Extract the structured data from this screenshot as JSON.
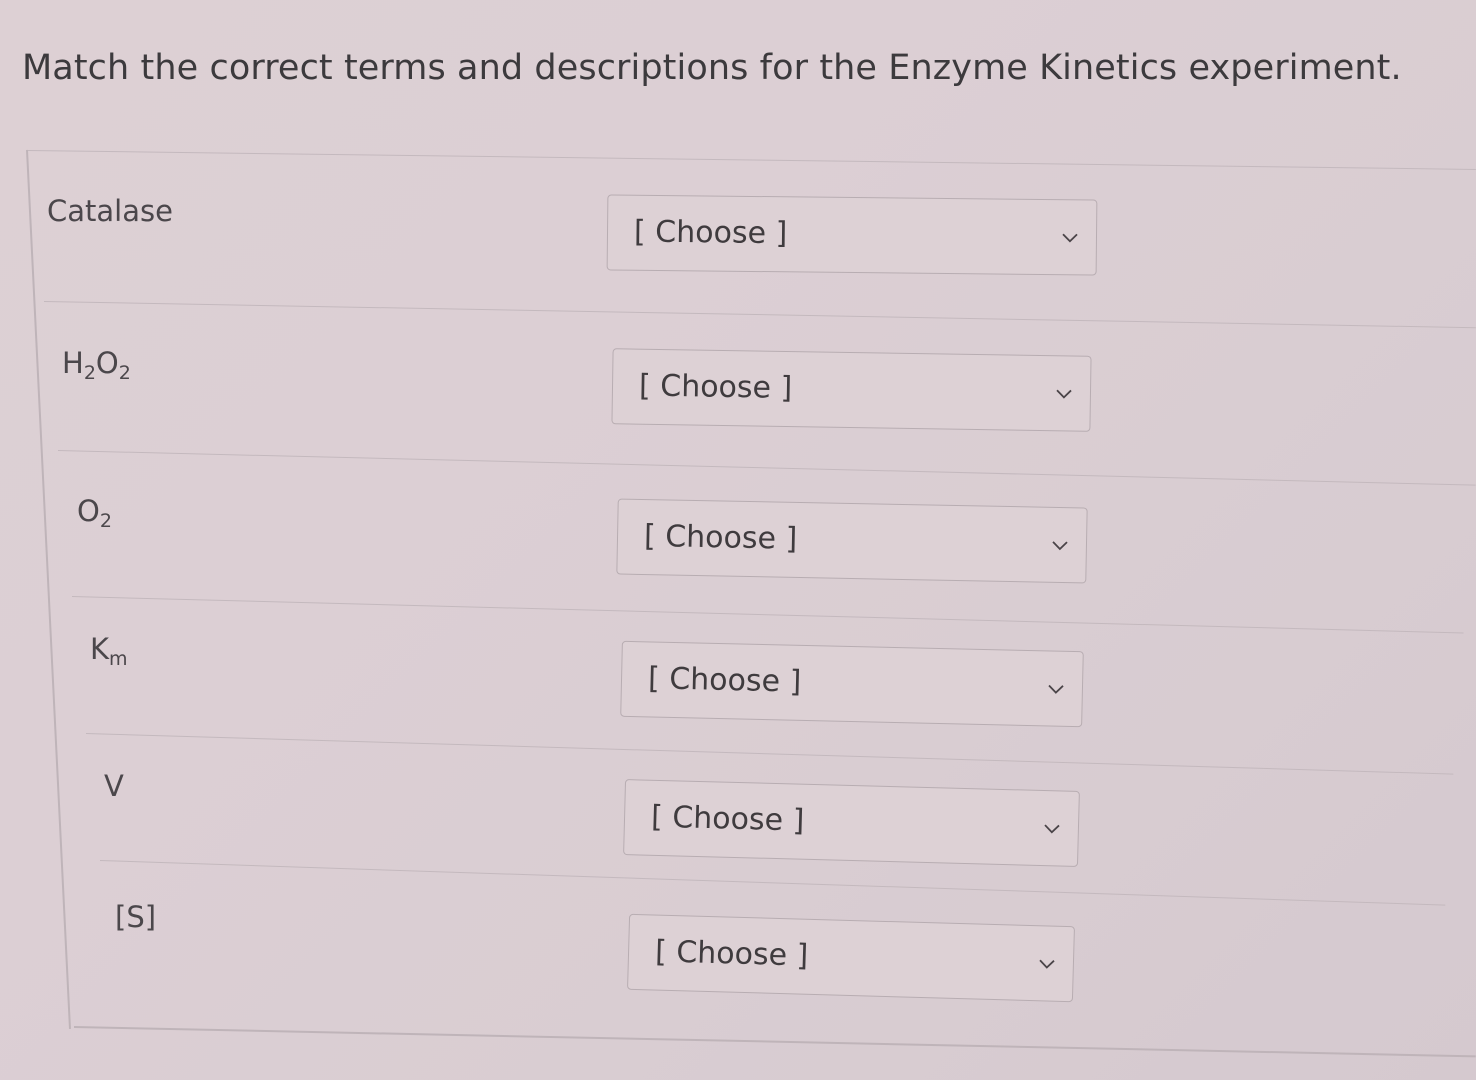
{
  "question": {
    "title": "Match the correct terms and descriptions for the Enzyme Kinetics experiment."
  },
  "rows": [
    {
      "term_main": "Catalase",
      "term_parts": [],
      "select_value": "[ Choose ]"
    },
    {
      "term_main": "",
      "term_parts": [
        "H",
        "2",
        "O",
        "2"
      ],
      "select_value": "[ Choose ]"
    },
    {
      "term_main": "",
      "term_parts": [
        "O",
        "2"
      ],
      "select_value": "[ Choose ]"
    },
    {
      "term_main": "",
      "term_parts": [
        "K",
        "m"
      ],
      "select_value": "[ Choose ]"
    },
    {
      "term_main": "V",
      "term_parts": [],
      "select_value": "[ Choose ]"
    },
    {
      "term_main": "[S]",
      "term_parts": [],
      "select_value": "[ Choose ]"
    }
  ],
  "colors": {
    "background": "#dacdd2",
    "border": "#b8adb2",
    "text": "#3f3b3e"
  },
  "icons": {
    "dropdown": "chevron-down-icon"
  }
}
